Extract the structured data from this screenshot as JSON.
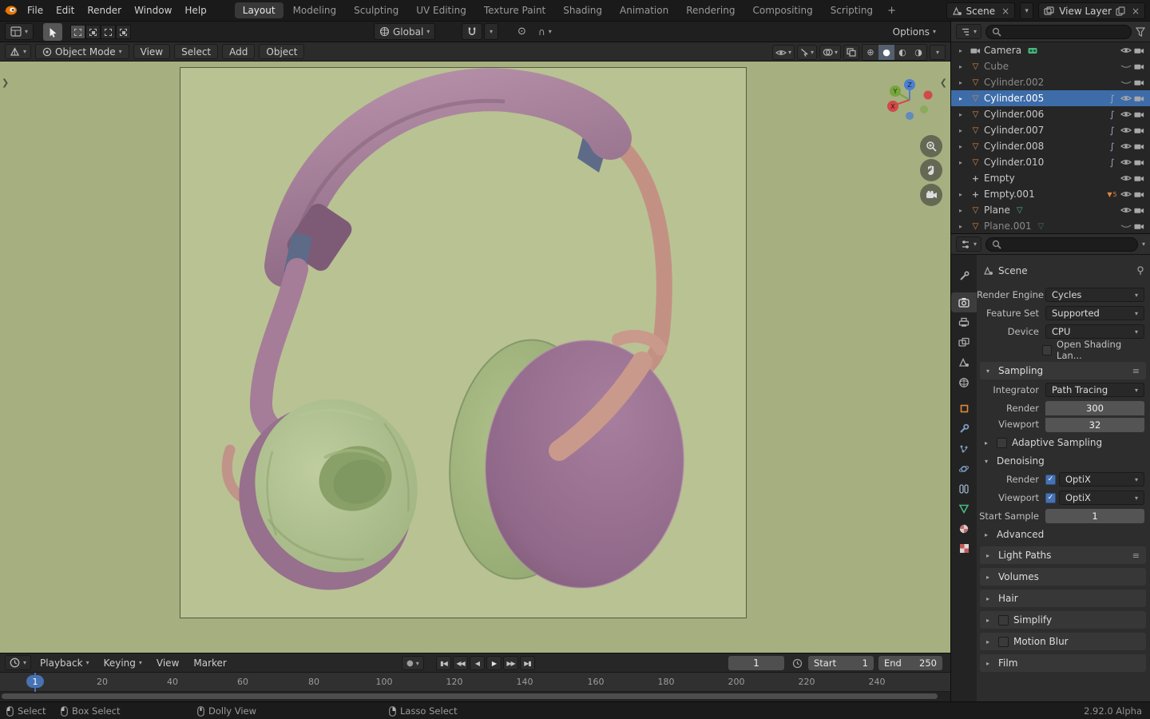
{
  "topbar": {
    "menus": [
      "File",
      "Edit",
      "Render",
      "Window",
      "Help"
    ],
    "workspaces": [
      "Layout",
      "Modeling",
      "Sculpting",
      "UV Editing",
      "Texture Paint",
      "Shading",
      "Animation",
      "Rendering",
      "Compositing",
      "Scripting"
    ],
    "add_tab": "+",
    "scene_selector": "Scene",
    "view_layer_selector": "View Layer"
  },
  "tool_settings": {
    "orientation": "Global",
    "options": "Options"
  },
  "viewport_header": {
    "mode": "Object Mode",
    "menus": [
      "View",
      "Select",
      "Add",
      "Object"
    ]
  },
  "outliner": {
    "items": [
      {
        "name": "Camera"
      },
      {
        "name": "Cube"
      },
      {
        "name": "Cylinder.002"
      },
      {
        "name": "Cylinder.005"
      },
      {
        "name": "Cylinder.006"
      },
      {
        "name": "Cylinder.007"
      },
      {
        "name": "Cylinder.008"
      },
      {
        "name": "Cylinder.010"
      },
      {
        "name": "Empty"
      },
      {
        "name": "Empty.001",
        "badge": "5"
      },
      {
        "name": "Plane"
      },
      {
        "name": "Plane.001"
      }
    ]
  },
  "properties": {
    "scene_name": "Scene",
    "render_engine_label": "Render Engine",
    "render_engine_value": "Cycles",
    "feature_set_label": "Feature Set",
    "feature_set_value": "Supported",
    "device_label": "Device",
    "device_value": "CPU",
    "open_shading_label": "Open Shading Lan...",
    "sampling_title": "Sampling",
    "integrator_label": "Integrator",
    "integrator_value": "Path Tracing",
    "render_label": "Render",
    "render_value": "300",
    "viewport_label": "Viewport",
    "viewport_value": "32",
    "adaptive_sampling_label": "Adaptive Sampling",
    "denoising_title": "Denoising",
    "denoise_render_label": "Render",
    "denoise_render_value": "OptiX",
    "denoise_viewport_label": "Viewport",
    "denoise_viewport_value": "OptiX",
    "start_sample_label": "Start Sample",
    "start_sample_value": "1",
    "advanced_title": "Advanced",
    "collapsed_sections": [
      "Light Paths",
      "Volumes",
      "Hair",
      "Simplify",
      "Motion Blur",
      "Film"
    ]
  },
  "timeline": {
    "menus": [
      "Playback",
      "Keying",
      "View",
      "Marker"
    ],
    "current_frame": "1",
    "playhead_frame": "1",
    "start_label": "Start",
    "start_value": "1",
    "end_label": "End",
    "end_value": "250",
    "ticks": [
      "20",
      "40",
      "60",
      "80",
      "100",
      "120",
      "140",
      "160",
      "180",
      "200",
      "220",
      "240"
    ]
  },
  "status_bar": {
    "hints": [
      "Select",
      "Box Select",
      "Dolly View",
      "Lasso Select"
    ],
    "version": "2.92.0 Alpha"
  },
  "icons": {
    "caret": "▾",
    "expand": "▸",
    "collapse": "▾",
    "close": "×",
    "check": "✓",
    "mesh": "▽",
    "empty_axes": "+",
    "fcurve": "∫",
    "funnel": "▼",
    "record": "●",
    "menu_lines": "≡",
    "wireframe_mode": "⊕",
    "solid_mode": "●",
    "material_mode": "◐",
    "rendered_mode": "◑",
    "prop_edit": "⊙",
    "prop_falloff": "∩",
    "jump_start": "▮◀",
    "prev_key": "◀◀",
    "play_rev": "◀",
    "play": "▶",
    "next_key": "▶▶",
    "jump_end": "▶▮"
  },
  "colors": {
    "selection_blue": "#3d6ca8",
    "object_orange": "#e0883d",
    "data_green": "#49b87f",
    "axis_x": "#d04a4a",
    "axis_y": "#76a53e",
    "axis_z": "#4b7fd0",
    "viewport_outer": "#a6af80",
    "viewport_inner": "#b9c293"
  }
}
